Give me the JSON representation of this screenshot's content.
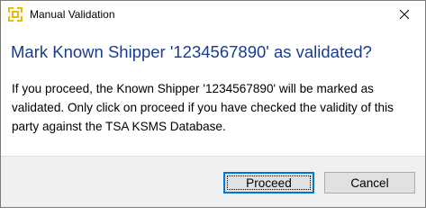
{
  "window": {
    "title": "Manual Validation",
    "close_glyph": "✕",
    "app_icon": "app-logo-icon",
    "close_icon": "close-icon"
  },
  "dialog": {
    "main_instruction": "Mark Known Shipper '1234567890' as validated?",
    "message": "If you proceed, the Known Shipper '1234567890' will be marked as validated. Only click on proceed if you have checked the validity of this party against the TSA KSMS Database."
  },
  "buttons": {
    "proceed_label": "Proceed",
    "cancel_label": "Cancel"
  },
  "colors": {
    "main_instruction": "#1a3c8c",
    "footer_background": "#f0f0f0",
    "default_button_border": "#0078d7",
    "app_icon": "#f5b800"
  }
}
